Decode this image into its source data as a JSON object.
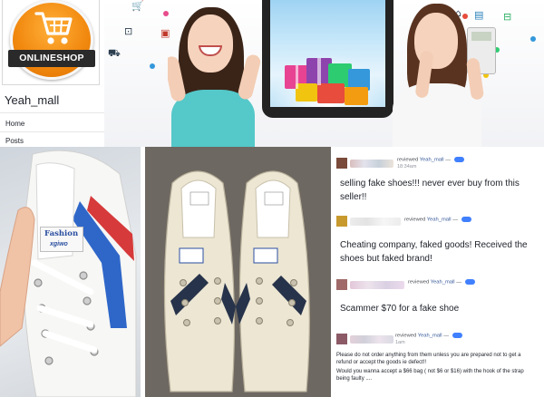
{
  "sidebar": {
    "logo_text": "ONLINESHOP",
    "page_name": "Yeah_mall",
    "nav": [
      {
        "label": "Home"
      },
      {
        "label": "Posts"
      }
    ]
  },
  "photo1": {
    "tag_line1": "Fashion",
    "tag_line2": "xgiwo"
  },
  "reviews": [
    {
      "reviewed": "reviewed",
      "page": "Yeah_mall",
      "time": "18:34am",
      "lines": [
        "selling fake shoes!!! never ever buy from this",
        "seller!!"
      ]
    },
    {
      "reviewed": "reviewed",
      "page": "Yeah_mall",
      "lines": [
        "Cheating company, faked goods! Received the",
        "shoes but faked brand!"
      ]
    },
    {
      "reviewed": "reviewed",
      "page": "Yeah_mall",
      "lines": [
        "Scammer $70 for a fake shoe"
      ]
    },
    {
      "reviewed": "reviewed",
      "page": "Yeah_mall",
      "time": "1am",
      "lines": [
        "Please do not order anything from them unless you are prepared not to get a",
        "refund or accept the goods ie defect!!",
        "Would you wanna accept a $66 bag ( not $6 or $16) with the hook of the strap",
        "being faulty ...."
      ]
    }
  ],
  "colors": {
    "logo_orange": "#f28a10",
    "facebook_blue": "#365899",
    "badge_blue": "#4080ff"
  }
}
